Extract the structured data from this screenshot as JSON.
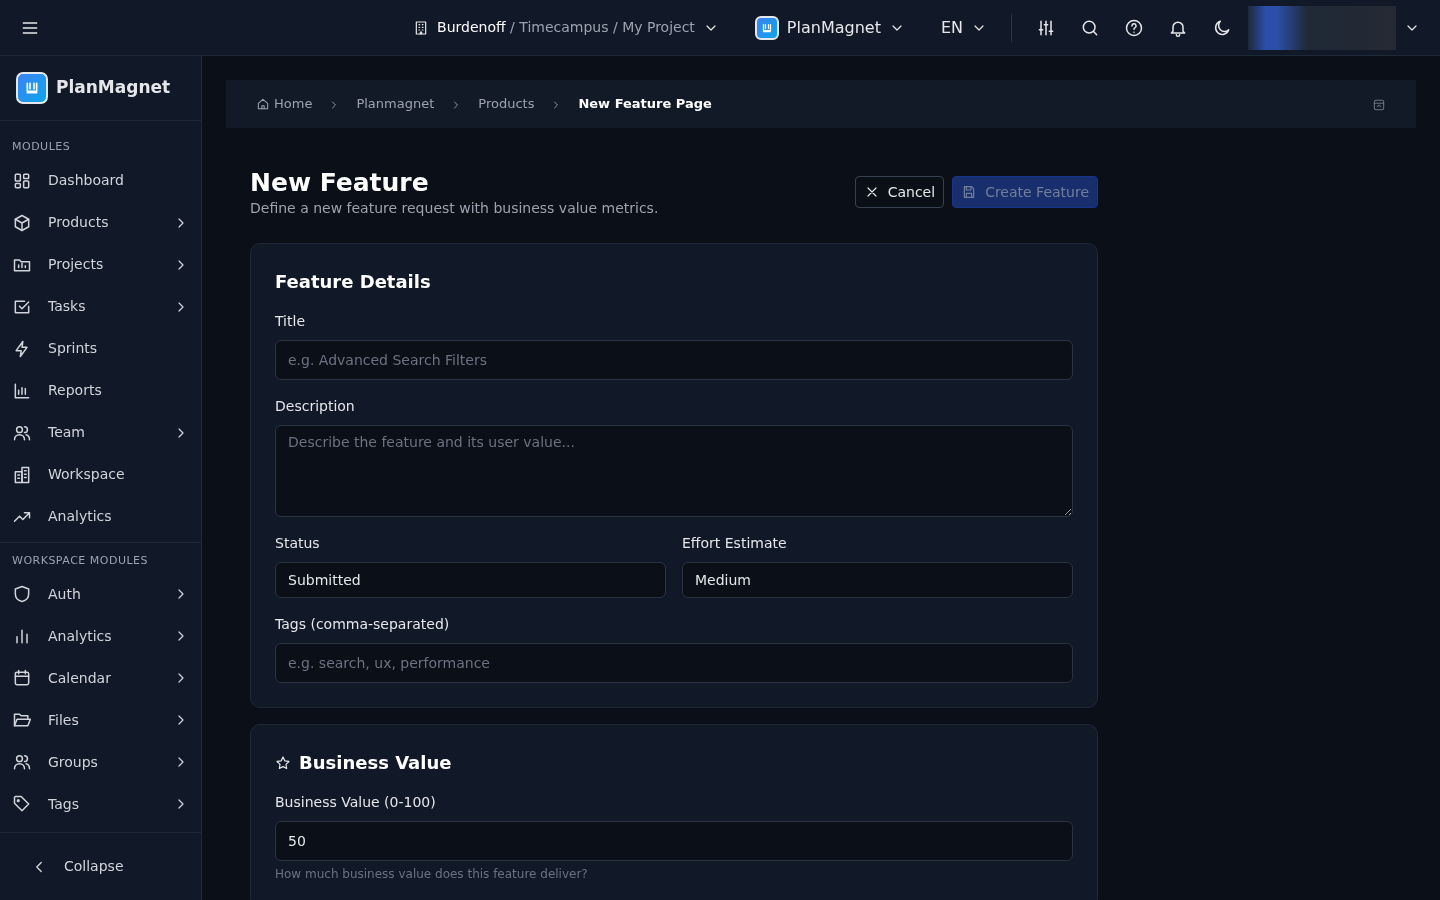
{
  "topbar": {
    "org": "Burdenoff",
    "path": " / Timecampus / My Project",
    "app": "PlanMagnet",
    "language": "EN"
  },
  "sidebar": {
    "brand": "PlanMagnet",
    "sections": [
      {
        "label": "MODULES",
        "items": [
          {
            "label": "Dashboard",
            "expandable": false
          },
          {
            "label": "Products",
            "expandable": true
          },
          {
            "label": "Projects",
            "expandable": true
          },
          {
            "label": "Tasks",
            "expandable": true
          },
          {
            "label": "Sprints",
            "expandable": false
          },
          {
            "label": "Reports",
            "expandable": false
          },
          {
            "label": "Team",
            "expandable": true
          },
          {
            "label": "Workspace",
            "expandable": false
          },
          {
            "label": "Analytics",
            "expandable": false
          }
        ]
      },
      {
        "label": "WORKSPACE MODULES",
        "items": [
          {
            "label": "Auth",
            "expandable": true
          },
          {
            "label": "Analytics",
            "expandable": true
          },
          {
            "label": "Calendar",
            "expandable": true
          },
          {
            "label": "Files",
            "expandable": true
          },
          {
            "label": "Groups",
            "expandable": true
          },
          {
            "label": "Tags",
            "expandable": true
          }
        ]
      }
    ],
    "collapse": "Collapse"
  },
  "breadcrumb": [
    "Home",
    "Planmagnet",
    "Products",
    "New Feature Page"
  ],
  "page": {
    "title": "New Feature",
    "subtitle": "Define a new feature request with business value metrics.",
    "cancel": "Cancel",
    "create": {
      "label": "Create Feature",
      "disabled": true
    }
  },
  "details": {
    "title": "Feature Details",
    "title_field": {
      "label": "Title",
      "placeholder": "e.g. Advanced Search Filters"
    },
    "description": {
      "label": "Description",
      "placeholder": "Describe the feature and its user value..."
    },
    "status": {
      "label": "Status",
      "value": "Submitted"
    },
    "effort": {
      "label": "Effort Estimate",
      "value": "Medium"
    },
    "tags": {
      "label": "Tags (comma-separated)",
      "placeholder": "e.g. search, ux, performance"
    }
  },
  "business": {
    "title": "Business Value",
    "label": "Business Value (0-100)",
    "value": "50",
    "hint": "How much business value does this feature deliver?"
  }
}
